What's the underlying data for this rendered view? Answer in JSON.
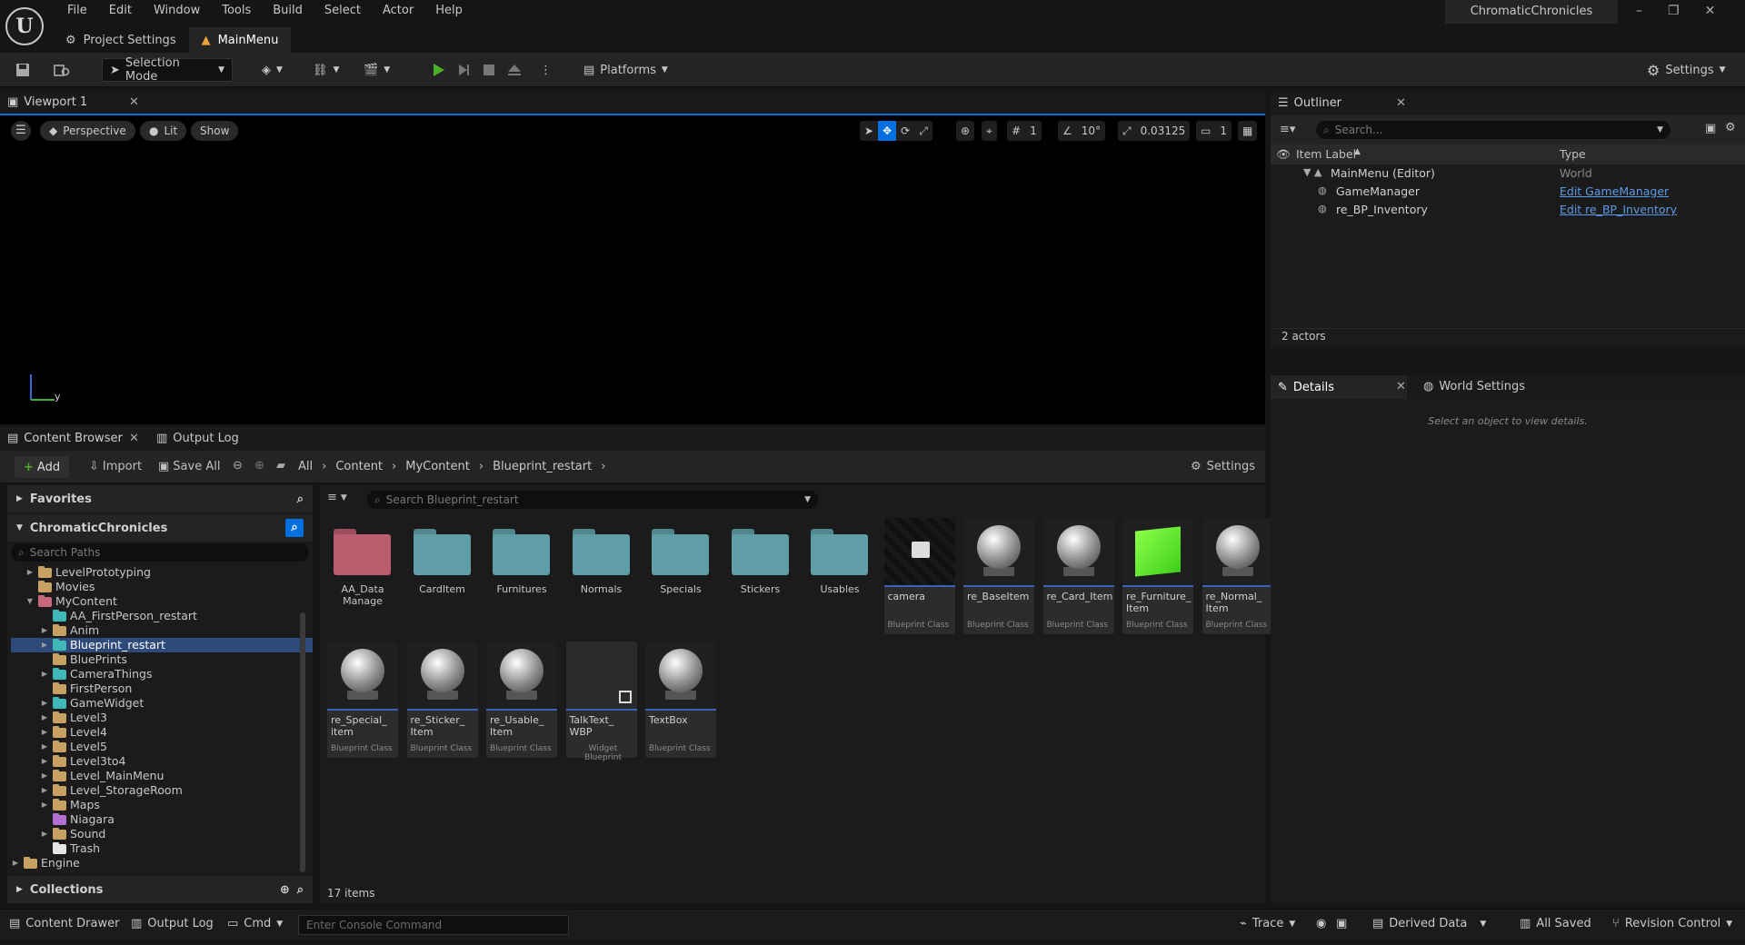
{
  "app": {
    "menus": [
      "File",
      "Edit",
      "Window",
      "Tools",
      "Build",
      "Select",
      "Actor",
      "Help"
    ],
    "project_name": "ChromaticChronicles",
    "tabs": [
      {
        "label": "Project Settings"
      },
      {
        "label": "MainMenu"
      }
    ]
  },
  "toolbar": {
    "selection_mode": "Selection Mode",
    "platforms": "Platforms",
    "settings": "Settings"
  },
  "viewport": {
    "tab_label": "Viewport 1",
    "perspective": "Perspective",
    "lit": "Lit",
    "show": "Show",
    "grid_value": "1",
    "angle_value": "10°",
    "scale_value": "0.03125",
    "camera_speed": "1",
    "axis_y": "y"
  },
  "content_browser": {
    "tab_label": "Content Browser",
    "output_log_tab": "Output Log",
    "add": "Add",
    "import": "Import",
    "save_all": "Save All",
    "breadcrumb": [
      "All",
      "Content",
      "MyContent",
      "Blueprint_restart"
    ],
    "settings": "Settings",
    "favorites": "Favorites",
    "project_root": "ChromaticChronicles",
    "search_paths_placeholder": "Search Paths",
    "search_assets_placeholder": "Search Blueprint_restart",
    "collections": "Collections",
    "item_count": "17 items",
    "tree": [
      {
        "label": "LevelPrototyping",
        "indent": 1,
        "expand": "▶",
        "color": "#c9a063"
      },
      {
        "label": "Movies",
        "indent": 1,
        "expand": "",
        "color": "#c9a063"
      },
      {
        "label": "MyContent",
        "indent": 1,
        "expand": "▼",
        "color": "#c9687c"
      },
      {
        "label": "AA_FirstPerson_restart",
        "indent": 2,
        "expand": "",
        "color": "#3fb8b8"
      },
      {
        "label": "Anim",
        "indent": 2,
        "expand": "▶",
        "color": "#c9a063"
      },
      {
        "label": "Blueprint_restart",
        "indent": 2,
        "expand": "▶",
        "color": "#3fb8b8",
        "selected": true
      },
      {
        "label": "BluePrints",
        "indent": 2,
        "expand": "",
        "color": "#c9a063"
      },
      {
        "label": "CameraThings",
        "indent": 2,
        "expand": "▶",
        "color": "#3fb8b8"
      },
      {
        "label": "FirstPerson",
        "indent": 2,
        "expand": "",
        "color": "#c9a063"
      },
      {
        "label": "GameWidget",
        "indent": 2,
        "expand": "▶",
        "color": "#3fb8b8"
      },
      {
        "label": "Level3",
        "indent": 2,
        "expand": "▶",
        "color": "#c9a063"
      },
      {
        "label": "Level4",
        "indent": 2,
        "expand": "▶",
        "color": "#c9a063"
      },
      {
        "label": "Level5",
        "indent": 2,
        "expand": "▶",
        "color": "#c9a063"
      },
      {
        "label": "Level3to4",
        "indent": 2,
        "expand": "▶",
        "color": "#c9a063"
      },
      {
        "label": "Level_MainMenu",
        "indent": 2,
        "expand": "▶",
        "color": "#c9a063"
      },
      {
        "label": "Level_StorageRoom",
        "indent": 2,
        "expand": "▶",
        "color": "#c9a063"
      },
      {
        "label": "Maps",
        "indent": 2,
        "expand": "▶",
        "color": "#c9a063"
      },
      {
        "label": "Niagara",
        "indent": 2,
        "expand": "",
        "color": "#b36fd1"
      },
      {
        "label": "Sound",
        "indent": 2,
        "expand": "▶",
        "color": "#c9a063"
      },
      {
        "label": "Trash",
        "indent": 2,
        "expand": "",
        "color": "#e6e6e6"
      },
      {
        "label": "Engine",
        "indent": 0,
        "expand": "▶",
        "color": "#c9a063"
      }
    ],
    "folders": [
      {
        "label": "AA_Data Manage",
        "color": "#b85c6e"
      },
      {
        "label": "CardItem",
        "color": "#5f9ea6"
      },
      {
        "label": "Furnitures",
        "color": "#5f9ea6"
      },
      {
        "label": "Normals",
        "color": "#5f9ea6"
      },
      {
        "label": "Specials",
        "color": "#5f9ea6"
      },
      {
        "label": "Stickers",
        "color": "#5f9ea6"
      },
      {
        "label": "Usables",
        "color": "#5f9ea6"
      }
    ],
    "assets": [
      {
        "label": "camera",
        "type": "Blueprint Class",
        "thumb": "camera"
      },
      {
        "label": "re_BaseItem",
        "type": "Blueprint Class",
        "thumb": "sphere"
      },
      {
        "label": "re_Card_Item",
        "type": "Blueprint Class",
        "thumb": "sphere"
      },
      {
        "label": "re_Furniture_ Item",
        "type": "Blueprint Class",
        "thumb": "cube"
      },
      {
        "label": "re_Normal_ Item",
        "type": "Blueprint Class",
        "thumb": "sphere"
      },
      {
        "label": "re_Special_ item",
        "type": "Blueprint Class",
        "thumb": "sphere"
      },
      {
        "label": "re_Sticker_ Item",
        "type": "Blueprint Class",
        "thumb": "sphere"
      },
      {
        "label": "re_Usable_ Item",
        "type": "Blueprint Class",
        "thumb": "sphere"
      },
      {
        "label": "TalkText_ WBP",
        "type": "Widget Blueprint",
        "thumb": "widget"
      },
      {
        "label": "TextBox",
        "type": "Blueprint Class",
        "thumb": "sphere"
      }
    ]
  },
  "outliner": {
    "tab_label": "Outliner",
    "search_placeholder": "Search...",
    "col_label": "Item Label",
    "col_type": "Type",
    "rows": [
      {
        "label": "MainMenu (Editor)",
        "type": "World",
        "link": false
      },
      {
        "label": "GameManager",
        "type": "Edit GameManager",
        "link": true
      },
      {
        "label": "re_BP_Inventory",
        "type": "Edit re_BP_Inventory",
        "link": true
      }
    ],
    "actor_count": "2 actors"
  },
  "details": {
    "tab_label": "Details",
    "world_settings_tab": "World Settings",
    "empty_message": "Select an object to view details."
  },
  "statusbar": {
    "content_drawer": "Content Drawer",
    "output_log": "Output Log",
    "cmd": "Cmd",
    "console_placeholder": "Enter Console Command",
    "trace": "Trace",
    "derived_data": "Derived Data",
    "all_saved": "All Saved",
    "revision_control": "Revision Control"
  }
}
